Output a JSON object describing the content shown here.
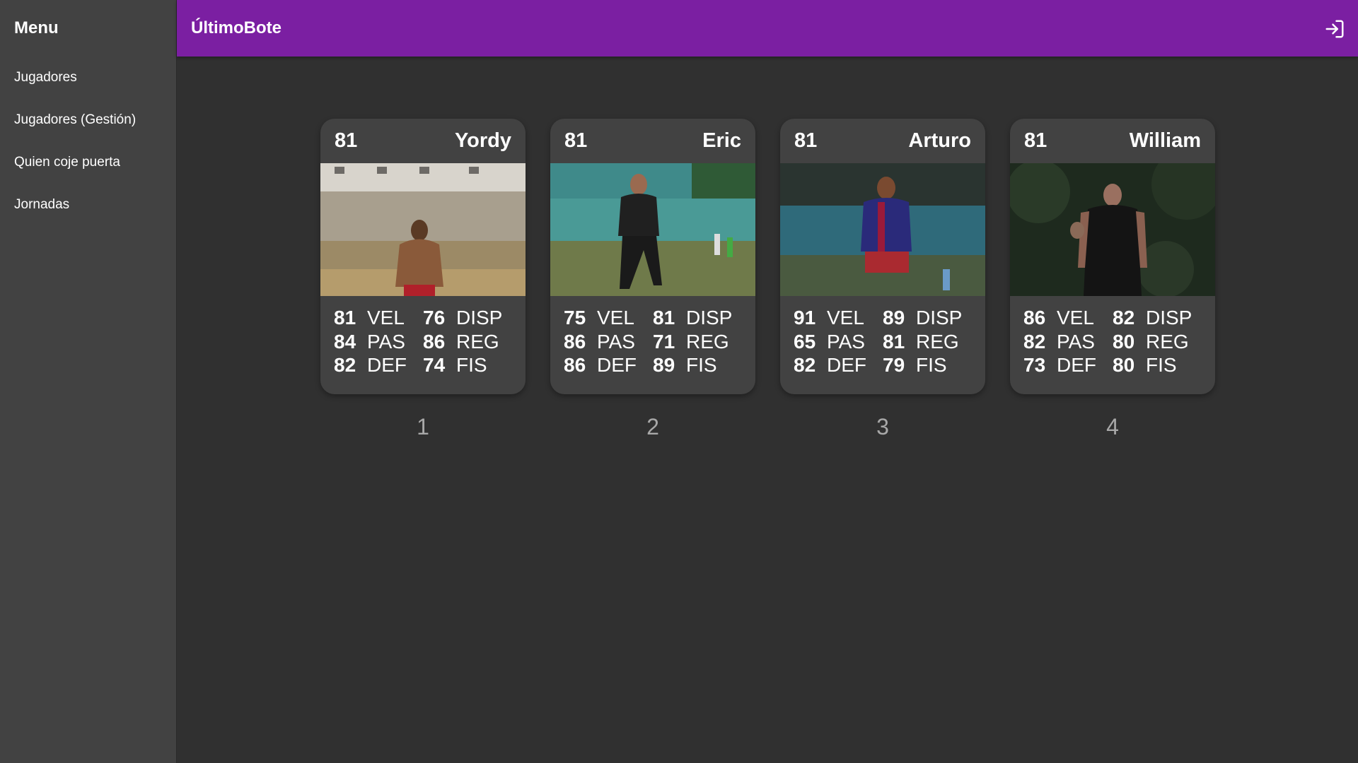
{
  "sidebar": {
    "title": "Menu",
    "items": [
      {
        "label": "Jugadores"
      },
      {
        "label": "Jugadores (Gestión)"
      },
      {
        "label": "Quien coje puerta"
      },
      {
        "label": "Jornadas"
      }
    ]
  },
  "header": {
    "title": "ÚltimoBote",
    "login_icon": "login-icon",
    "accent_color": "#7b1fa2"
  },
  "players": [
    {
      "rating": "81",
      "name": "Yordy",
      "position": "1",
      "stats": [
        {
          "value": "81",
          "label": "VEL"
        },
        {
          "value": "84",
          "label": "PAS"
        },
        {
          "value": "82",
          "label": "DEF"
        },
        {
          "value": "76",
          "label": "DISP"
        },
        {
          "value": "86",
          "label": "REG"
        },
        {
          "value": "74",
          "label": "FIS"
        }
      ]
    },
    {
      "rating": "81",
      "name": "Eric",
      "position": "2",
      "stats": [
        {
          "value": "75",
          "label": "VEL"
        },
        {
          "value": "86",
          "label": "PAS"
        },
        {
          "value": "86",
          "label": "DEF"
        },
        {
          "value": "81",
          "label": "DISP"
        },
        {
          "value": "71",
          "label": "REG"
        },
        {
          "value": "89",
          "label": "FIS"
        }
      ]
    },
    {
      "rating": "81",
      "name": "Arturo",
      "position": "3",
      "stats": [
        {
          "value": "91",
          "label": "VEL"
        },
        {
          "value": "65",
          "label": "PAS"
        },
        {
          "value": "82",
          "label": "DEF"
        },
        {
          "value": "89",
          "label": "DISP"
        },
        {
          "value": "81",
          "label": "REG"
        },
        {
          "value": "79",
          "label": "FIS"
        }
      ]
    },
    {
      "rating": "81",
      "name": "William",
      "position": "4",
      "stats": [
        {
          "value": "86",
          "label": "VEL"
        },
        {
          "value": "82",
          "label": "PAS"
        },
        {
          "value": "73",
          "label": "DEF"
        },
        {
          "value": "82",
          "label": "DISP"
        },
        {
          "value": "80",
          "label": "REG"
        },
        {
          "value": "80",
          "label": "FIS"
        }
      ]
    }
  ]
}
